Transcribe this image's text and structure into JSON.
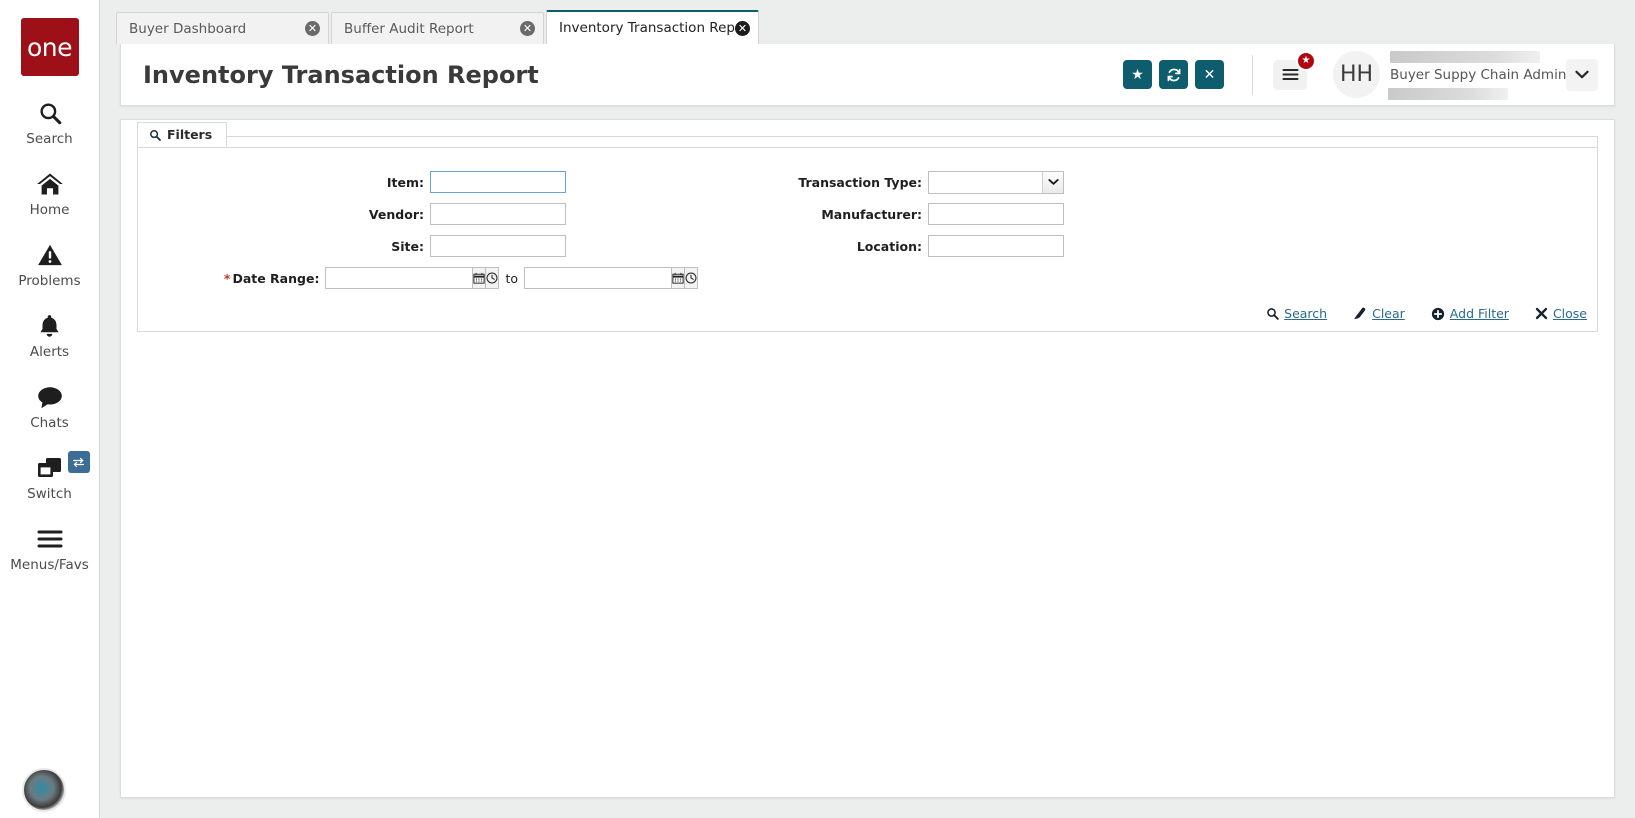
{
  "brand": {
    "logo_text": "one",
    "logo_color": "#9e1017",
    "accent_teal": "#0d5d6e",
    "link_blue": "#2a6a8c",
    "badge_red": "#b00710"
  },
  "sidebar": {
    "items": [
      {
        "label": "Search",
        "icon": "search-icon"
      },
      {
        "label": "Home",
        "icon": "home-icon"
      },
      {
        "label": "Problems",
        "icon": "warning-triangle-icon"
      },
      {
        "label": "Alerts",
        "icon": "bell-icon"
      },
      {
        "label": "Chats",
        "icon": "chat-bubble-icon"
      },
      {
        "label": "Switch",
        "icon": "windows-stack-icon",
        "badge_icon": "swap-arrows-icon"
      },
      {
        "label": "Menus/Favs",
        "icon": "hamburger-icon"
      }
    ],
    "bottom_avatar": "user-photo-avatar"
  },
  "tabs": [
    {
      "label": "Buyer Dashboard",
      "active": false,
      "close_icon": "close-circle-icon"
    },
    {
      "label": "Buffer Audit Report",
      "active": false,
      "close_icon": "close-circle-icon"
    },
    {
      "label": "Inventory Transaction Report",
      "active": true,
      "close_icon": "close-circle-icon"
    }
  ],
  "header": {
    "title": "Inventory Transaction Report",
    "buttons": [
      {
        "name": "favorite-button",
        "icon": "star-icon",
        "glyph": "★"
      },
      {
        "name": "refresh-button",
        "icon": "refresh-icon",
        "glyph": "↻"
      },
      {
        "name": "close-button",
        "icon": "x-icon",
        "glyph": "✕"
      }
    ],
    "menu_button": {
      "icon": "hamburger-icon",
      "badge_icon": "star-badge-icon",
      "badge_glyph": "★"
    },
    "avatar_initials": "HH",
    "user_role": "Buyer Suppy Chain Admin",
    "user_name_redacted": true,
    "caret_icon": "chevron-down-icon"
  },
  "filters": {
    "tab_label": "Filters",
    "tab_icon": "search-icon",
    "left_fields": [
      {
        "label": "Item:",
        "value": "",
        "placeholder": "",
        "type": "text",
        "focused": true,
        "required": false
      },
      {
        "label": "Vendor:",
        "value": "",
        "placeholder": "",
        "type": "text",
        "focused": false,
        "required": false
      },
      {
        "label": "Site:",
        "value": "",
        "placeholder": "",
        "type": "text",
        "focused": false,
        "required": false
      },
      {
        "label": "Date Range:",
        "value": "",
        "placeholder": "",
        "type": "daterange",
        "focused": false,
        "required": true
      }
    ],
    "right_fields": [
      {
        "label": "Transaction Type:",
        "value": "",
        "placeholder": "",
        "type": "select",
        "options": [
          ""
        ],
        "required": false
      },
      {
        "label": "Manufacturer:",
        "value": "",
        "placeholder": "",
        "type": "text",
        "required": false
      },
      {
        "label": "Location:",
        "value": "",
        "placeholder": "",
        "type": "text",
        "required": false
      }
    ],
    "date_range_separator": "to",
    "date_calendar_icon": "calendar-icon",
    "date_clock_icon": "clock-icon",
    "actions": [
      {
        "label": "Search",
        "icon": "search-icon"
      },
      {
        "label": "Clear",
        "icon": "eraser-icon"
      },
      {
        "label": "Add Filter",
        "icon": "plus-circle-icon"
      },
      {
        "label": "Close",
        "icon": "x-icon"
      }
    ]
  }
}
